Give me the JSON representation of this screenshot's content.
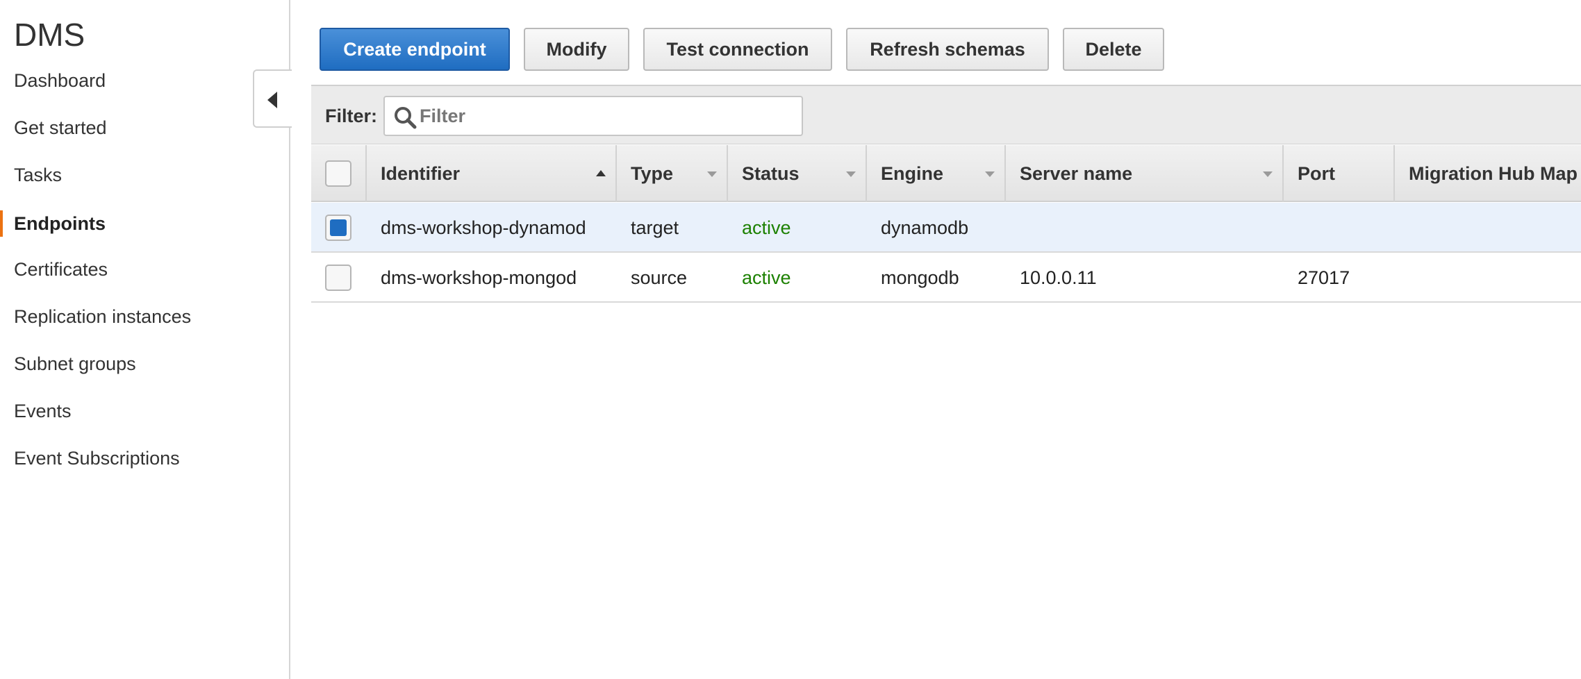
{
  "sidebar": {
    "title": "DMS",
    "items": [
      {
        "label": "Dashboard"
      },
      {
        "label": "Get started"
      },
      {
        "label": "Tasks"
      },
      {
        "label": "Endpoints"
      },
      {
        "label": "Certificates"
      },
      {
        "label": "Replication instances"
      },
      {
        "label": "Subnet groups"
      },
      {
        "label": "Events"
      },
      {
        "label": "Event Subscriptions"
      }
    ],
    "active_item": "Endpoints"
  },
  "toolbar": {
    "create_label": "Create endpoint",
    "modify_label": "Modify",
    "test_label": "Test connection",
    "refresh_label": "Refresh schemas",
    "delete_label": "Delete"
  },
  "filter": {
    "label": "Filter:",
    "placeholder": "Filter",
    "value": ""
  },
  "table": {
    "columns": [
      "Identifier",
      "Type",
      "Status",
      "Engine",
      "Server name",
      "Port",
      "Migration Hub Map"
    ],
    "sorted_by": "Identifier",
    "rows": [
      {
        "selected": true,
        "identifier": "dms-workshop-dynamod",
        "type": "target",
        "status": "active",
        "engine": "dynamodb",
        "server_name": "",
        "port": ""
      },
      {
        "selected": false,
        "identifier": "dms-workshop-mongod",
        "type": "source",
        "status": "active",
        "engine": "mongodb",
        "server_name": "10.0.0.11",
        "port": "27017"
      }
    ]
  },
  "colors": {
    "primary": "#1f6dc1",
    "active_status": "#1d8102",
    "nav_accent": "#ec7211",
    "selected_row": "#e9f1fb"
  },
  "icons": [
    "collapse-left-icon",
    "search-icon",
    "sort-ascending-icon",
    "sort-dropdown-icon"
  ]
}
